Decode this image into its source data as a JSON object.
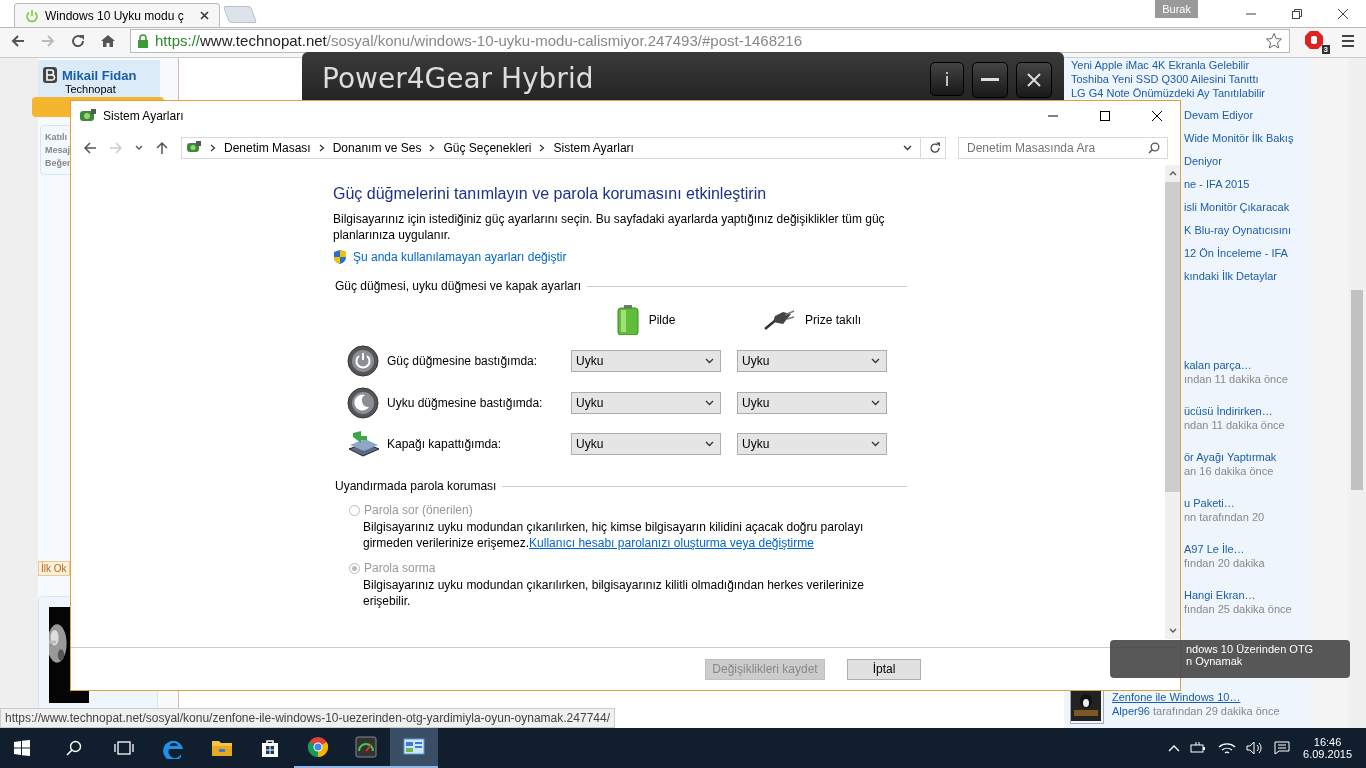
{
  "browser": {
    "tab_title": "Windows 10 Uyku modu ç",
    "profile": "Burak",
    "url_scheme": "https://",
    "url_host": "www.technopat.net",
    "url_path": "/sosyal/konu/windows-10-uyku-modu-calismiyor.247493/#post-1468216",
    "extension_badge": "3",
    "status_url": "https://www.technopat.net/sosyal/konu/zenfone-ile-windows-10-uezerinden-otg-yardimiyla-oyun-oynamak.247744/"
  },
  "page": {
    "author": {
      "name": "Mikail Fidan",
      "title": "Technopat"
    },
    "author_stats": [
      "Katılı",
      "Mesaj",
      "Beğen"
    ],
    "tag": "İlk Ok",
    "headlines": [
      "Yeni Apple iMac 4K Ekranla Gelebilir",
      "Toshiba Yeni SSD Q300 Ailesini Tanıttı",
      "LG G4 Note Önümüzdeki Ay Tanıtılabilir"
    ],
    "more_headlines": [
      "Devam Ediyor",
      "Wide Monitör İlk Bakış",
      "Deniyor",
      "ne - IFA 2015",
      "isli Monitör Çıkaracak",
      "K Blu-ray Oynatıcısını",
      "12 Ön İnceleme - IFA",
      "kındaki İlk Detaylar"
    ],
    "recent_threads": [
      {
        "title": "kalan parça…",
        "meta": "ından 11 dakika önce"
      },
      {
        "title": "ücüsü İndirirken…",
        "meta": "ndan 11 dakika önce"
      },
      {
        "title": "ör Ayağı Yaptırmak",
        "meta": "an 16 dakika önce"
      },
      {
        "title": "u Paketi…",
        "meta": "nn tarafından 20"
      },
      {
        "title": "A97 Le İle…",
        "meta": "fından 20 dakika"
      },
      {
        "title": "Hangi Ekran…",
        "meta": "fından 25 dakika önce"
      }
    ],
    "last_thread": {
      "title": "Zenfone ile Windows 10…",
      "author": "Alper96",
      "meta": "tarafından 29 dakika önce"
    }
  },
  "tooltip": {
    "lines": [
      "ndows 10 Üzerinden OTG",
      "n Oynamak"
    ]
  },
  "power4gear": {
    "title": "Power4Gear Hybrid",
    "info_button": "i"
  },
  "dialog": {
    "title": "Sistem Ayarları",
    "breadcrumbs": [
      "Denetim Masası",
      "Donanım ve Ses",
      "Güç Seçenekleri",
      "Sistem Ayarları"
    ],
    "search_placeholder": "Denetim Masasında Ara",
    "heading": "Güç düğmelerini tanımlayın ve parola korumasını etkinleştirin",
    "description": "Bilgisayarınız için istediğiniz güç ayarlarını seçin. Bu sayfadaki ayarlarda yaptığınız değişiklikler tüm güç planlarınıza uygulanır.",
    "admin_link": "Şu anda kullanılamayan ayarları değiştir",
    "buttons_section": "Güç düğmesi, uyku düğmesi ve kapak ayarları",
    "columns": [
      "Pilde",
      "Prize takılı"
    ],
    "rows": [
      {
        "kind": "power",
        "label": "Güç düğmesine bastığımda:",
        "on_battery": "Uyku",
        "plugged_in": "Uyku"
      },
      {
        "kind": "sleep",
        "label": "Uyku düğmesine bastığımda:",
        "on_battery": "Uyku",
        "plugged_in": "Uyku"
      },
      {
        "kind": "lid",
        "label": "Kapağı kapattığımda:",
        "on_battery": "Uyku",
        "plugged_in": "Uyku"
      }
    ],
    "password_section": "Uyandırmada parola koruması",
    "password_options": [
      {
        "label": "Parola sor (önerilen)",
        "description": "Bilgisayarınız uyku modundan çıkarılırken, hiç kimse bilgisayarın kilidini açacak doğru parolayı girmeden verilerinize erişemez.",
        "link": "Kullanıcı hesabı parolanızı oluşturma veya değiştirme",
        "selected": false,
        "disabled": true
      },
      {
        "label": "Parola sorma",
        "description": "Bilgisayarınız uyku modundan çıkarılırken, bilgisayarınız kilitli olmadığından herkes verilerinize erişebilir.",
        "selected": true,
        "disabled": true
      }
    ],
    "buttons": [
      {
        "label": "Değişiklikleri kaydet",
        "disabled": true
      },
      {
        "label": "İptal",
        "disabled": false
      }
    ]
  },
  "taskbar": {
    "apps": [
      {
        "kind": "edge",
        "selected": false,
        "running": false
      },
      {
        "kind": "explorer",
        "selected": false,
        "running": false
      },
      {
        "kind": "store",
        "selected": false,
        "running": false
      },
      {
        "kind": "chrome",
        "selected": false,
        "running": true
      },
      {
        "kind": "gauge",
        "selected": false,
        "running": true
      },
      {
        "kind": "control-panel",
        "selected": true,
        "running": true
      }
    ],
    "time": "16:46",
    "date": "6.09.2015"
  }
}
